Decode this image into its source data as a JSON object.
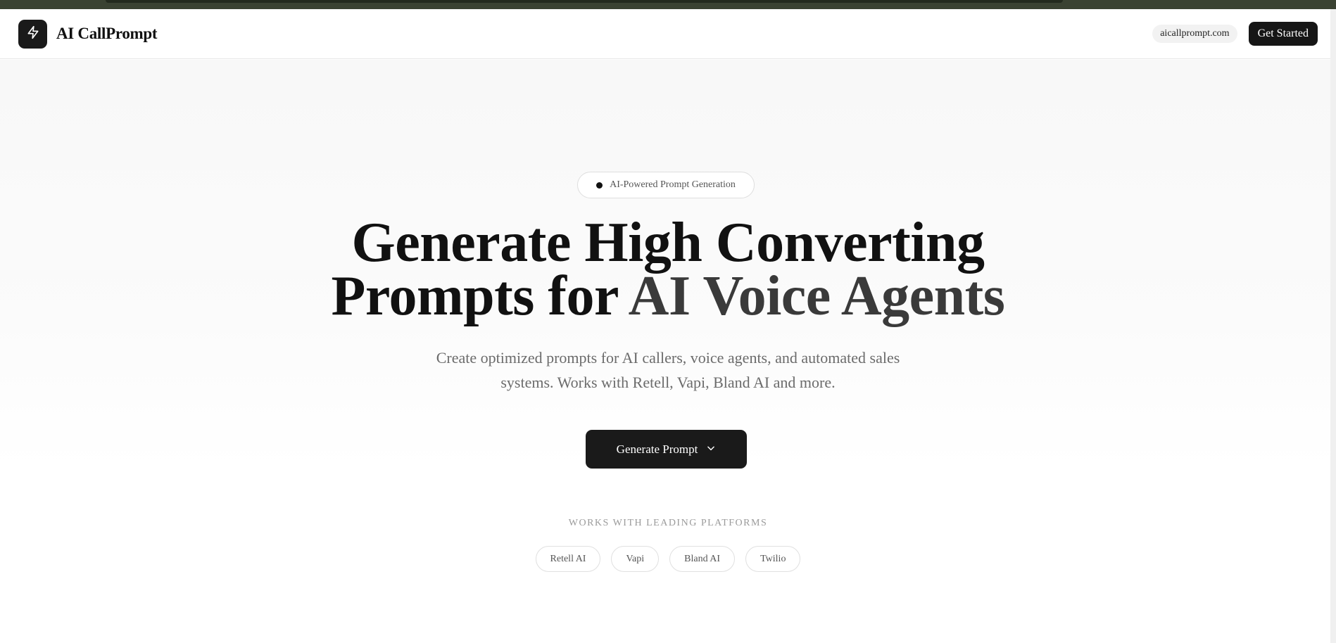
{
  "colors": {
    "primary": "#1a1a1a",
    "accent_text": "#3a3a3a",
    "muted_text": "#6b6b6b",
    "top_strip": "#3a4232"
  },
  "header": {
    "brand_name": "AI CallPrompt",
    "logo_icon": "lightning-bolt-icon",
    "domain": "aicallprompt.com",
    "cta_label": "Get Started"
  },
  "hero": {
    "badge_text": "AI-Powered Prompt Generation",
    "headline_line1": "Generate High Converting",
    "headline_line2_prefix": "Prompts for ",
    "headline_line2_accent": "AI Voice Agents",
    "subtitle": "Create optimized prompts for AI callers, voice agents, and automated sales systems. Works with Retell, Vapi, Bland AI and more.",
    "cta_label": "Generate Prompt",
    "cta_icon": "chevron-down-icon"
  },
  "platforms": {
    "label": "WORKS WITH LEADING PLATFORMS",
    "items": [
      "Retell AI",
      "Vapi",
      "Bland AI",
      "Twilio"
    ]
  }
}
